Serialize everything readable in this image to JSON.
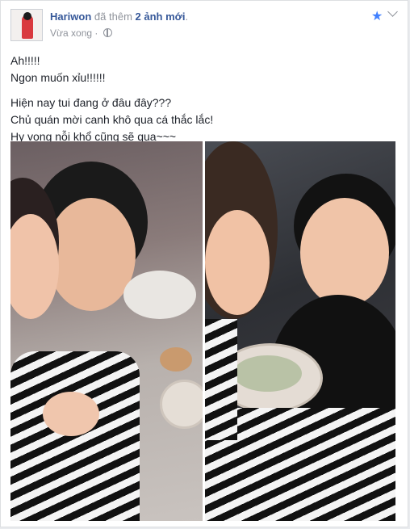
{
  "header": {
    "author": "Hariwon",
    "action_prefix": "đã thêm",
    "action_count": "2 ảnh mới",
    "action_suffix": ".",
    "timestamp": "Vừa xong",
    "separator": "·"
  },
  "icons": {
    "privacy": "globe-icon",
    "favorite": "star-icon",
    "menu": "chevron-down-icon"
  },
  "colors": {
    "link": "#365899",
    "meta": "#90949c",
    "text": "#1d2129",
    "star": "#4080ff"
  },
  "post": {
    "line1": "Ah!!!!!",
    "line2": "Ngon muốn xỉu!!!!!!",
    "line3": "Hiện nay tui đang ở đâu đây???",
    "line4": "Chủ quán mời canh khô qua cá thắc lắc!",
    "line5": "Hy vọng nỗi khổ cũng sẽ qua~~~"
  },
  "photos": [
    {
      "name": "selfie-photo-1"
    },
    {
      "name": "selfie-photo-2"
    }
  ]
}
